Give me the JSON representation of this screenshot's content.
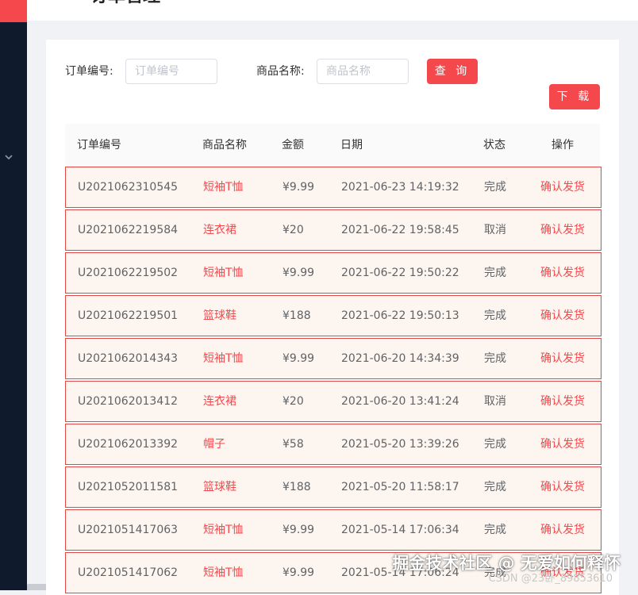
{
  "colors": {
    "accent": "#f5484d",
    "sidebar": "#0f1b2d",
    "row_bg": "#fdf6f0",
    "row_border": "#e04848"
  },
  "page": {
    "title": "订单管理"
  },
  "sidebar": {
    "chevron_icon": "chevron-down-icon"
  },
  "filters": {
    "order_no_label": "订单编号:",
    "order_no_placeholder": "订单编号",
    "order_no_value": "",
    "product_label": "商品名称:",
    "product_placeholder": "商品名称",
    "product_value": "",
    "search_label": "查 询",
    "download_label": "下 载"
  },
  "table": {
    "headers": {
      "id": "订单编号",
      "name": "商品名称",
      "amount": "金额",
      "date": "日期",
      "status": "状态",
      "op": "操作"
    },
    "rows": [
      {
        "id": "U2021062310545",
        "name": "短袖T恤",
        "amount": "¥9.99",
        "date": "2021-06-23 14:19:32",
        "status": "完成",
        "op": "确认发货"
      },
      {
        "id": "U2021062219584",
        "name": "连衣裙",
        "amount": "¥20",
        "date": "2021-06-22 19:58:45",
        "status": "取消",
        "op": "确认发货"
      },
      {
        "id": "U2021062219502",
        "name": "短袖T恤",
        "amount": "¥9.99",
        "date": "2021-06-22 19:50:22",
        "status": "完成",
        "op": "确认发货"
      },
      {
        "id": "U2021062219501",
        "name": "篮球鞋",
        "amount": "¥188",
        "date": "2021-06-22 19:50:13",
        "status": "完成",
        "op": "确认发货"
      },
      {
        "id": "U2021062014343",
        "name": "短袖T恤",
        "amount": "¥9.99",
        "date": "2021-06-20 14:34:39",
        "status": "完成",
        "op": "确认发货"
      },
      {
        "id": "U2021062013412",
        "name": "连衣裙",
        "amount": "¥20",
        "date": "2021-06-20 13:41:24",
        "status": "取消",
        "op": "确认发货"
      },
      {
        "id": "U2021062013392",
        "name": "帽子",
        "amount": "¥58",
        "date": "2021-05-20 13:39:26",
        "status": "完成",
        "op": "确认发货"
      },
      {
        "id": "U2021052011581",
        "name": "篮球鞋",
        "amount": "¥188",
        "date": "2021-05-20 11:58:17",
        "status": "完成",
        "op": "确认发货"
      },
      {
        "id": "U2021051417063",
        "name": "短袖T恤",
        "amount": "¥9.99",
        "date": "2021-05-14 17:06:34",
        "status": "完成",
        "op": "确认发货"
      },
      {
        "id": "U2021051417062",
        "name": "短袖T恤",
        "amount": "¥9.99",
        "date": "2021-05-14 17:06:24",
        "status": "完成",
        "op": "确认发货"
      }
    ]
  },
  "watermark": {
    "main": "掘金技术社区 @ 无爱如何释怀",
    "sub": "CSDN @23卧_89853610"
  }
}
